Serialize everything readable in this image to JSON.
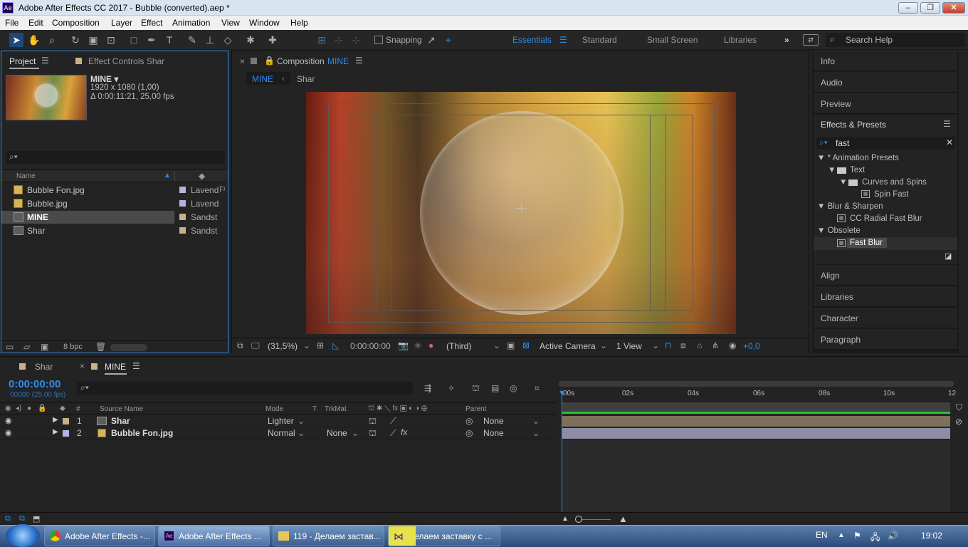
{
  "window": {
    "title": "Adobe After Effects CC 2017 - Bubble (converted).aep *",
    "logo": "Ae",
    "min": "–",
    "max": "❐",
    "close": "✕"
  },
  "menu": [
    "File",
    "Edit",
    "Composition",
    "Layer",
    "Effect",
    "Animation",
    "View",
    "Window",
    "Help"
  ],
  "toolbar": {
    "snapping": "Snapping",
    "workspaces": [
      "Essentials",
      "Standard",
      "Small Screen",
      "Libraries"
    ],
    "active_workspace": "Essentials",
    "search_help": "Search Help"
  },
  "project": {
    "tab": "Project",
    "effect_tab": "Effect Controls Shar",
    "comp_name": "MINE ▾",
    "comp_size": "1920 x 1080 (1,00)",
    "comp_duration": "Δ 0:00:11:21, 25,00 fps",
    "col_name": "Name",
    "items": [
      {
        "name": "Bubble Fon.jpg",
        "label": "Lavend",
        "color": "#b7b3e0"
      },
      {
        "name": "Bubble.jpg",
        "label": "Lavend",
        "color": "#b7b3e0"
      },
      {
        "name": "MINE",
        "label": "Sandst",
        "color": "#c8b087"
      },
      {
        "name": "Shar",
        "label": "Sandst",
        "color": "#c8b087"
      }
    ],
    "bpc": "8 bpc"
  },
  "composition": {
    "tab_prefix": "Composition",
    "tab_name": "MINE",
    "crumbs": [
      "MINE",
      "Shar"
    ],
    "zoom": "(31,5%)",
    "timecode": "0:00:00:00",
    "resolution": "(Third)",
    "camera": "Active Camera",
    "views": "1 View",
    "exposure": "+0,0"
  },
  "right_panels": {
    "top": [
      "Info",
      "Audio",
      "Preview"
    ],
    "effects_title": "Effects & Presets",
    "search": "fast",
    "tree": [
      {
        "text": "▼ * Animation Presets",
        "indent": 0
      },
      {
        "text": "▼",
        "folder": "Text",
        "indent": 1
      },
      {
        "text": "▼",
        "folder": "Curves and Spins",
        "indent": 2
      },
      {
        "text": "Spin Fast",
        "preset": true,
        "indent": 3
      },
      {
        "text": "▼ Blur & Sharpen",
        "indent": 0
      },
      {
        "text": "CC Radial Fast Blur",
        "preset": true,
        "indent": 1
      },
      {
        "text": "▼ Obsolete",
        "indent": 0
      },
      {
        "text": "Fast Blur",
        "preset": true,
        "indent": 1,
        "selected": true
      }
    ],
    "bottom": [
      "Align",
      "Libraries",
      "Character",
      "Paragraph"
    ]
  },
  "timeline": {
    "tabs": [
      "Shar",
      "MINE"
    ],
    "timecode": "0:00:00:00",
    "frames": "00000 (25.00 fps)",
    "cols": {
      "num": "#",
      "source": "Source Name",
      "mode": "Mode",
      "t": "T",
      "trkmat": "TrkMat",
      "parent": "Parent"
    },
    "layers": [
      {
        "num": "1",
        "name": "Shar",
        "mode": "Lighter",
        "trkmat": "",
        "parent": "None",
        "color": "#c8b087"
      },
      {
        "num": "2",
        "name": "Bubble Fon.jpg",
        "mode": "Normal",
        "trkmat": "None",
        "parent": "None",
        "color": "#b7b3e0"
      }
    ],
    "ruler": [
      "00s",
      "02s",
      "04s",
      "06s",
      "08s",
      "10s",
      "12"
    ]
  },
  "taskbar": {
    "items": [
      "Adobe After Effects -...",
      "Adobe After Effects ...",
      "119 - Делаем застав...",
      "Делаем заставку с ..."
    ],
    "lang": "EN",
    "clock": "19:02"
  }
}
